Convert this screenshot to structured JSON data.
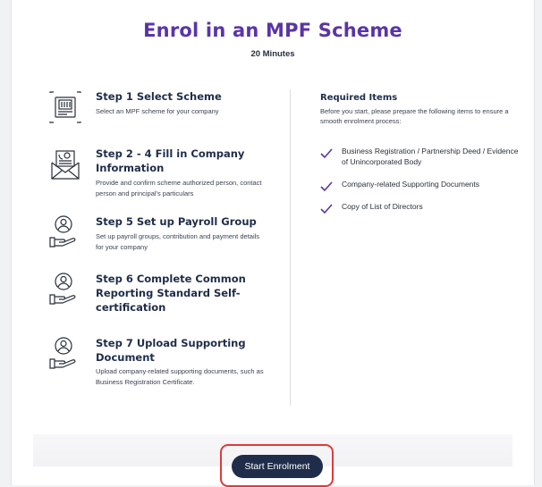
{
  "page": {
    "title": "Enrol in an MPF Scheme",
    "duration": "20 Minutes"
  },
  "steps": [
    {
      "title": "Step 1 Select Scheme",
      "desc": "Select an MPF scheme for your company",
      "icon": "building-document-icon"
    },
    {
      "title": "Step 2 - 4 Fill in Company Information",
      "desc": "Provide and confirm scheme authorized person, contact person and principal's particulars",
      "icon": "contact-envelope-icon"
    },
    {
      "title": "Step 5 Set up Payroll Group",
      "desc": "Set up payroll groups, contribution and payment details for your company",
      "icon": "person-hand-icon"
    },
    {
      "title": "Step 6 Complete Common Reporting Standard Self-certification",
      "desc": "",
      "icon": "person-hand-icon"
    },
    {
      "title": "Step 7 Upload Supporting Document",
      "desc": "Upload company-related supporting documents, such as Business Registration Certificate.",
      "icon": "person-hand-icon"
    }
  ],
  "required": {
    "title": "Required Items",
    "intro": "Before you start, please prepare the following items to ensure a smooth enrolment process:",
    "items": [
      "Business Registration / Partnership Deed / Evidence of Unincorporated Body",
      "Company-related Supporting Documents",
      "Copy of List of Directors"
    ]
  },
  "actions": {
    "start_label": "Start Enrolment"
  },
  "colors": {
    "title": "#5a35a6",
    "check": "#5a35a6",
    "button": "#1f2d4a",
    "highlight": "#e03a3a"
  }
}
